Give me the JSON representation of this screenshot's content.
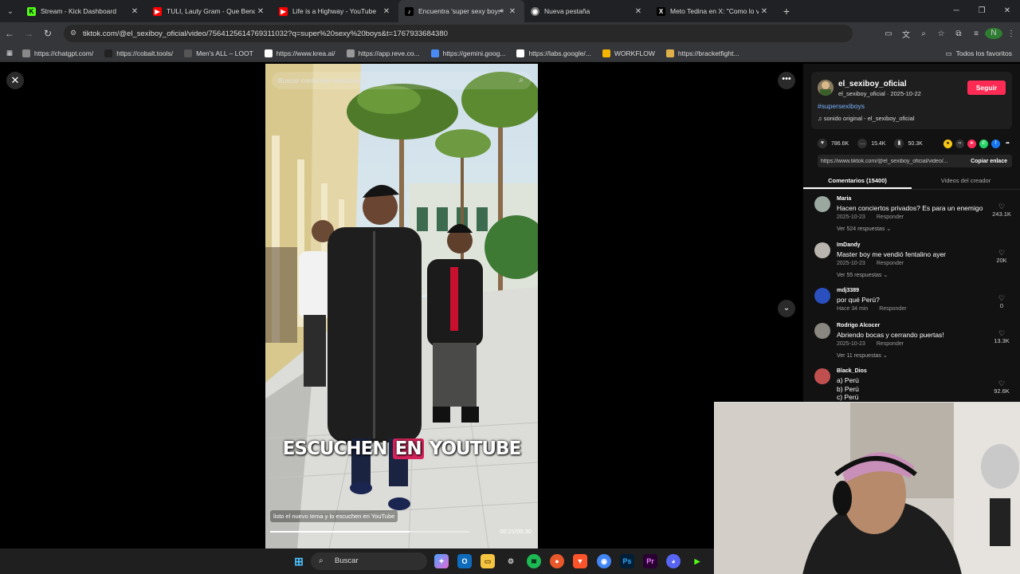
{
  "browser": {
    "tabs": [
      {
        "title": "Stream - Kick Dashboard",
        "icon": "kick-icon",
        "active": false
      },
      {
        "title": "TULI, Lauty Gram - Que Bendic",
        "icon": "youtube-icon",
        "active": false
      },
      {
        "title": "Life is a Highway - YouTube",
        "icon": "youtube-icon",
        "active": false
      },
      {
        "title": "Encuentra 'super sexy boys",
        "icon": "tiktok-icon",
        "active": true
      },
      {
        "title": "Nueva pestaña",
        "icon": "chrome-icon",
        "active": false
      },
      {
        "title": "Meto Tedina en X: \"Como lo vo",
        "icon": "x-icon",
        "active": false
      }
    ],
    "url": "tiktok.com/@el_sexiboy_oficial/video/7564125614769311032?q=super%20sexy%20boys&t=1767933684380",
    "profile_initial": "N",
    "bookmarks": [
      {
        "label": "https://chatgpt.com/",
        "icon": "globe-icon"
      },
      {
        "label": "https://cobalt.tools/",
        "icon": "cobalt-icon"
      },
      {
        "label": "Men's ALL – LOOT",
        "icon": "loot-icon"
      },
      {
        "label": "https://www.krea.ai/",
        "icon": "krea-icon"
      },
      {
        "label": "https://app.reve.co...",
        "icon": "reve-icon"
      },
      {
        "label": "https://gemini.goog...",
        "icon": "gemini-icon"
      },
      {
        "label": "https://labs.google/...",
        "icon": "doc-icon"
      },
      {
        "label": "WORKFLOW",
        "icon": "drive-icon"
      },
      {
        "label": "https://bracketfight...",
        "icon": "bracket-icon"
      }
    ],
    "all_favorites": "Todos los favoritos"
  },
  "video": {
    "search_placeholder": "Buscar contenido relacionado",
    "caption_pre": "ESCUCHEN",
    "caption_hl": "EN",
    "caption_post": "YOUTUBE",
    "description": "listo el nuevo tema y lo escuchen en YouTube",
    "time": "00:21/00:30",
    "progress": 0.7
  },
  "post": {
    "username": "el_sexiboy_oficial",
    "subline": "el_sexiboy_oficial · 2025-10-22",
    "follow_label": "Seguir",
    "hashtag": "#supersexiboys",
    "sound": "♫ sonido original - el_sexiboy_oficial",
    "likes": "786.6K",
    "comments_count": "15.4K",
    "saves": "50.3K",
    "share_url": "https://www.tiktok.com/@el_sexiboy_oficial/video/...",
    "copy_label": "Copiar enlace"
  },
  "comments_tabs": {
    "comments": "Comentarios (15400)",
    "creator": "Videos del creador"
  },
  "comments": [
    {
      "user": "Maria",
      "text": "Hacen conciertos privados? Es para un enemigo",
      "date": "2025-10-23",
      "reply": "Responder",
      "likes": "243.1K",
      "replies": "Ver 524 respuestas ⌄",
      "avatar": "#9aa8a0"
    },
    {
      "user": "ImDandy",
      "text": "Master boy me vendió fentalino ayer",
      "date": "2025-10-23",
      "reply": "Responder",
      "likes": "20K",
      "replies": "Ver 55 respuestas ⌄",
      "avatar": "#b9b5ae"
    },
    {
      "user": "mdj3389",
      "text": "por qué Perú?",
      "date": "Hace 34 min",
      "reply": "Responder",
      "likes": "0",
      "replies": "",
      "avatar": "#2a4fbf"
    },
    {
      "user": "Rodrigo Alcocer",
      "text": "Abriendo bocas y cerrando puertas!",
      "date": "2025-10-23",
      "reply": "Responder",
      "likes": "13.3K",
      "replies": "Ver 11 respuestas ⌄",
      "avatar": "#8a8680"
    },
    {
      "user": "Black_Dios",
      "text": "a) Perú\nb) Perú\nc) Perú",
      "date": "",
      "reply": "",
      "likes": "92.6K",
      "replies": "",
      "avatar": "#c05050"
    }
  ],
  "taskbar": {
    "search_label": "Buscar"
  },
  "colors": {
    "follow": "#fe2c55",
    "hashtag": "#7ab2ff",
    "caption_highlight": "#d6245b"
  }
}
